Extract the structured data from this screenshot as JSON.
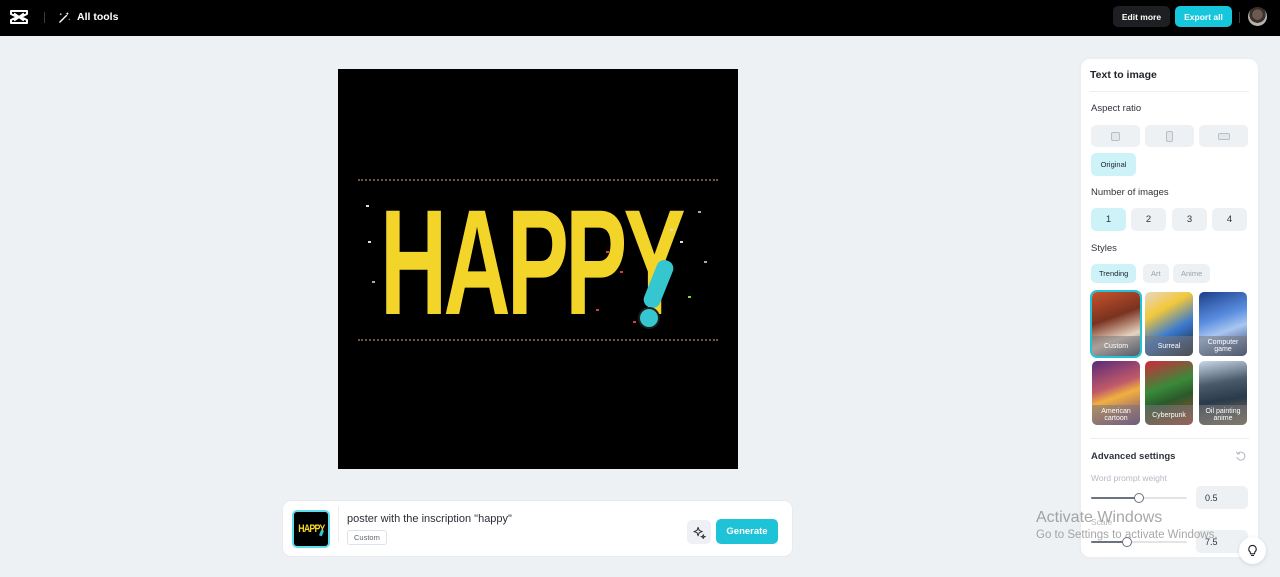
{
  "topbar": {
    "logo_icon": "capcut-logo-icon",
    "all_tools_label": "All tools",
    "edit_more_label": "Edit more",
    "export_all_label": "Export all",
    "accent_color": "#16c7dc"
  },
  "canvas": {
    "image_text": "HAPPY",
    "image_description": "Poster with yellow 'HAPPY' lettering and cyan exclamation mark on black"
  },
  "prompt": {
    "thumbnail_text": "HAPPY",
    "text": "poster with the inscription \"happy\"",
    "style_tag": "Custom",
    "generate_label": "Generate"
  },
  "panel": {
    "title": "Text to image",
    "aspect_ratio": {
      "label": "Aspect ratio",
      "options": [
        "square",
        "portrait",
        "landscape"
      ],
      "original_label": "Original",
      "selected": "Original"
    },
    "number_of_images": {
      "label": "Number of images",
      "options": [
        "1",
        "2",
        "3",
        "4"
      ],
      "selected": "1"
    },
    "styles": {
      "label": "Styles",
      "tabs": [
        "Trending",
        "Art",
        "Anime"
      ],
      "active_tab": "Trending",
      "cards": [
        {
          "label": "Custom",
          "selected": true
        },
        {
          "label": "Surreal",
          "selected": false
        },
        {
          "label": "Computer game",
          "selected": false
        },
        {
          "label": "American cartoon",
          "selected": false
        },
        {
          "label": "Cyberpunk",
          "selected": false
        },
        {
          "label": "Oil painting anime",
          "selected": false
        }
      ]
    },
    "advanced": {
      "label": "Advanced settings",
      "word_prompt_weight": {
        "label": "Word prompt weight",
        "value": "0.5",
        "fraction": 0.5
      },
      "scale": {
        "label": "Scale",
        "value": "7.5",
        "fraction": 0.37
      }
    }
  },
  "watermark": {
    "line1": "Activate Windows",
    "line2": "Go to Settings to activate Windows."
  }
}
